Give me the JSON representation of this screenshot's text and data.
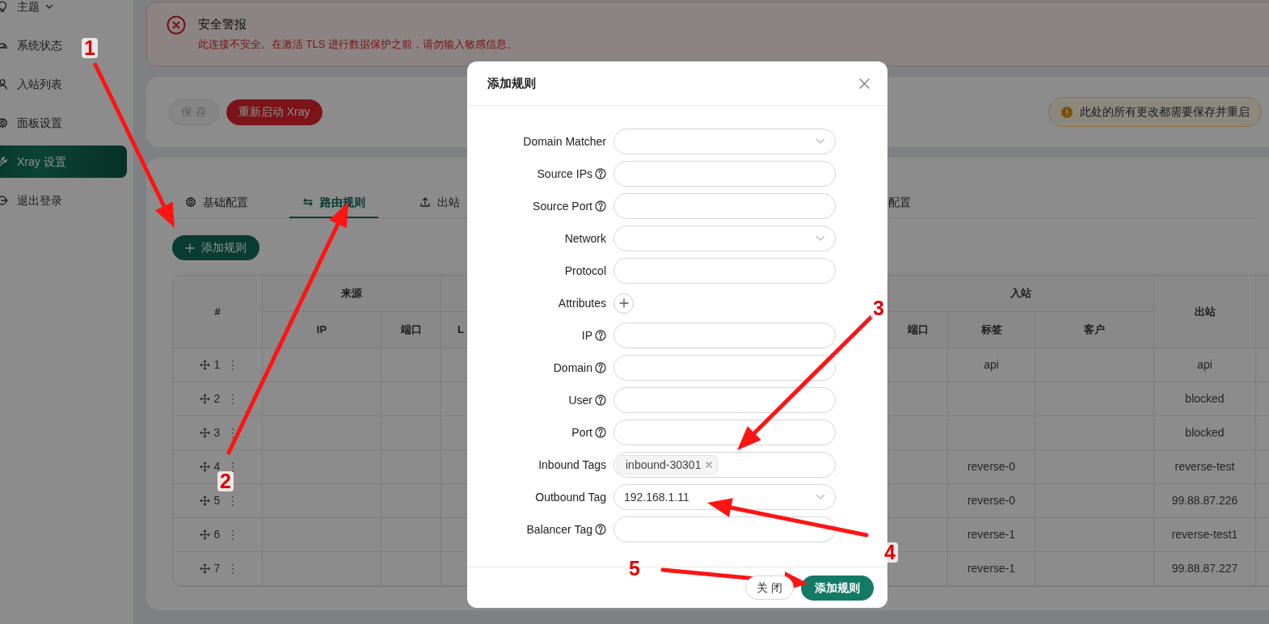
{
  "sidebar": {
    "items": [
      {
        "label": "主题",
        "expandable": true,
        "selected": false
      },
      {
        "label": "系统状态",
        "selected": false
      },
      {
        "label": "入站列表",
        "selected": false
      },
      {
        "label": "面板设置",
        "selected": false
      },
      {
        "label": "Xray 设置",
        "selected": true
      },
      {
        "label": "退出登录",
        "selected": false
      }
    ]
  },
  "alert": {
    "title": "安全警报",
    "message": "此连接不安全。在激活 TLS 进行数据保护之前，请勿输入敏感信息。"
  },
  "toolbar": {
    "buttons": [
      {
        "label": "保 存",
        "disabled": true
      },
      {
        "label": "重新启动 Xray",
        "disabled": false
      }
    ],
    "notice": "此处的所有更改都需要保存并重启"
  },
  "tabs": [
    {
      "label": "基础配置",
      "selected": false
    },
    {
      "label": "路由规则",
      "selected": true
    },
    {
      "label": "出站",
      "selected": false
    },
    {
      "label": "配置",
      "selected": false
    }
  ],
  "add_button": "添加规则",
  "table": {
    "columns": [
      {
        "label": "#"
      },
      {
        "label": "来源",
        "children": [
          {
            "label": "IP"
          },
          {
            "label": "端口"
          }
        ]
      },
      {
        "children": [
          {
            "label": "L"
          }
        ]
      },
      {
        "label": "入站",
        "children": [
          {
            "label": "端口"
          },
          {
            "label": "标签"
          },
          {
            "label": "客户"
          }
        ]
      },
      {
        "label": "出站"
      }
    ],
    "rows": [
      {
        "index": "1",
        "inbound_tag": "api",
        "outbound": "api"
      },
      {
        "index": "2",
        "outbound": "blocked"
      },
      {
        "index": "3",
        "outbound": "blocked"
      },
      {
        "index": "4",
        "inbound_tag": "reverse-0",
        "outbound": "reverse-test"
      },
      {
        "index": "5",
        "inbound_tag": "reverse-0",
        "outbound": "99.88.87.226"
      },
      {
        "index": "6",
        "inbound_tag": "reverse-1",
        "outbound": "reverse-test1"
      },
      {
        "index": "7",
        "inbound_tag": "reverse-1",
        "outbound": "99.88.87.227"
      }
    ]
  },
  "dialog": {
    "title": "添加规则",
    "fields": [
      {
        "label": "Domain Matcher",
        "kind": "select"
      },
      {
        "label": "Source IPs",
        "kind": "text",
        "help": true
      },
      {
        "label": "Source Port",
        "kind": "text",
        "help": true
      },
      {
        "label": "Network",
        "kind": "select"
      },
      {
        "label": "Protocol",
        "kind": "text"
      },
      {
        "label": "Attributes",
        "kind": "add"
      },
      {
        "label": "IP",
        "kind": "text",
        "help": true
      },
      {
        "label": "Domain",
        "kind": "text",
        "help": true
      },
      {
        "label": "User",
        "kind": "text",
        "help": true
      },
      {
        "label": "Port",
        "kind": "text",
        "help": true
      },
      {
        "label": "Inbound Tags",
        "kind": "tags",
        "tags": [
          "inbound-30301"
        ]
      },
      {
        "label": "Outbound Tag",
        "kind": "select",
        "value": "192.168.1.11"
      },
      {
        "label": "Balancer Tag",
        "kind": "text",
        "help": true
      }
    ],
    "buttons": [
      {
        "label": "关 闭",
        "kind": "secondary"
      },
      {
        "label": "添加规则",
        "kind": "primary"
      }
    ]
  },
  "annotations": [
    {
      "label": "1"
    },
    {
      "label": "2"
    },
    {
      "label": "3"
    },
    {
      "label": "4"
    },
    {
      "label": "5"
    }
  ]
}
